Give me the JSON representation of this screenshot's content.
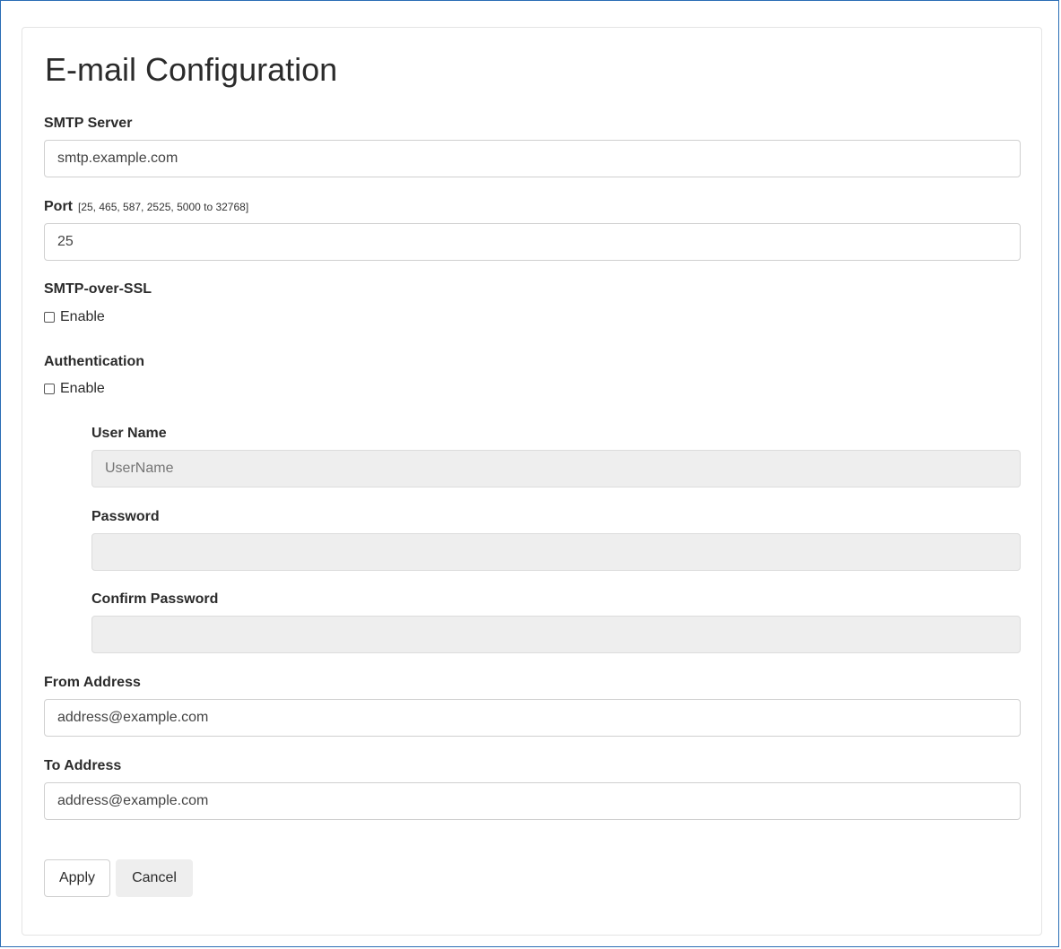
{
  "page": {
    "title": "E-mail Configuration"
  },
  "smtp_server": {
    "label": "SMTP Server",
    "value": "smtp.example.com"
  },
  "port": {
    "label": "Port",
    "hint": "[25, 465, 587, 2525, 5000 to 32768]",
    "value": "25"
  },
  "smtp_over_ssl": {
    "label": "SMTP-over-SSL",
    "checkbox_label": "Enable",
    "checked": false
  },
  "authentication": {
    "label": "Authentication",
    "checkbox_label": "Enable",
    "checked": false,
    "user_name": {
      "label": "User Name",
      "value": "UserName"
    },
    "password": {
      "label": "Password",
      "value": ""
    },
    "confirm_password": {
      "label": "Confirm Password",
      "value": ""
    }
  },
  "from_address": {
    "label": "From Address",
    "value": "address@example.com"
  },
  "to_address": {
    "label": "To Address",
    "value": "address@example.com"
  },
  "actions": {
    "apply_label": "Apply",
    "cancel_label": "Cancel"
  },
  "colors": {
    "frame_border": "#2a6db5",
    "input_border": "#d0d0d0",
    "disabled_input_bg": "#eeeeee",
    "cancel_button_bg": "#eeeeee"
  }
}
